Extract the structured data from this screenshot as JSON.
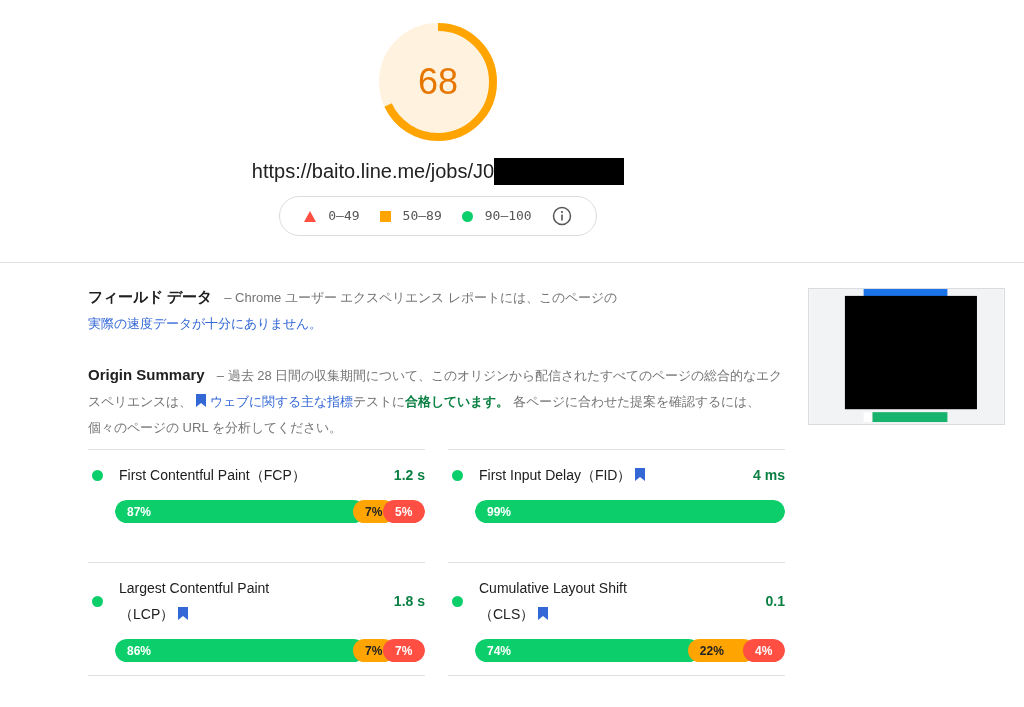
{
  "gauge": {
    "score": "68"
  },
  "url": {
    "text": "https://baito.line.me/jobs/J0"
  },
  "legend": [
    {
      "kind": "fail",
      "label": "0–49"
    },
    {
      "kind": "average",
      "label": "50–89"
    },
    {
      "kind": "pass",
      "label": "90–100"
    }
  ],
  "field_data": {
    "title": "フィールド データ",
    "parts": [
      {
        "kind": "text",
        "text": "– Chrome ユーザー エクスペリエンス レポートには、このページの"
      },
      {
        "kind": "link",
        "text": "実際の速度データが十分にありません。"
      }
    ]
  },
  "origin_summary": {
    "title": "Origin Summary",
    "parts": [
      {
        "kind": "text",
        "text": "– 過去 28 日間の収集期間について、このオリジンから配信されたすべてのページの総合的なエクスペリエンスは、"
      },
      {
        "kind": "link",
        "text": "ウェブに関する主な指標",
        "bookmark": true
      },
      {
        "kind": "text",
        "text": "テストに"
      },
      {
        "kind": "pass",
        "text": "合格しています。"
      },
      {
        "kind": "text",
        "text": " 各ページに合わせた提案を確認するには、個々のページの URL を分析してください。"
      }
    ]
  },
  "metrics": [
    {
      "name": "First Contentful Paint（FCP）",
      "bookmark": false,
      "value": "1.2 s",
      "color": "#0cce6b",
      "segments": [
        {
          "kind": "pass",
          "label": "87%"
        },
        {
          "kind": "average",
          "label": "7%"
        },
        {
          "kind": "fail",
          "label": "5%"
        }
      ]
    },
    {
      "name": "First Input Delay（FID）",
      "bookmark": true,
      "value": "4 ms",
      "color": "#0cce6b",
      "segments": [
        {
          "kind": "pass",
          "label": "99%"
        }
      ]
    },
    {
      "name": "Largest Contentful Paint",
      "name_suffix": "（LCP）",
      "bookmark": true,
      "value": "1.8 s",
      "color": "#0cce6b",
      "segments": [
        {
          "kind": "pass",
          "label": "86%"
        },
        {
          "kind": "average",
          "label": "7%"
        },
        {
          "kind": "fail",
          "label": "7%"
        }
      ]
    },
    {
      "name": "Cumulative Layout Shift",
      "name_suffix": "（CLS）",
      "bookmark": true,
      "value": "0.1",
      "color": "#0cce6b",
      "segments": [
        {
          "kind": "pass",
          "label": "74%"
        },
        {
          "kind": "average",
          "label": "22%"
        },
        {
          "kind": "fail",
          "label": "4%"
        }
      ]
    }
  ]
}
